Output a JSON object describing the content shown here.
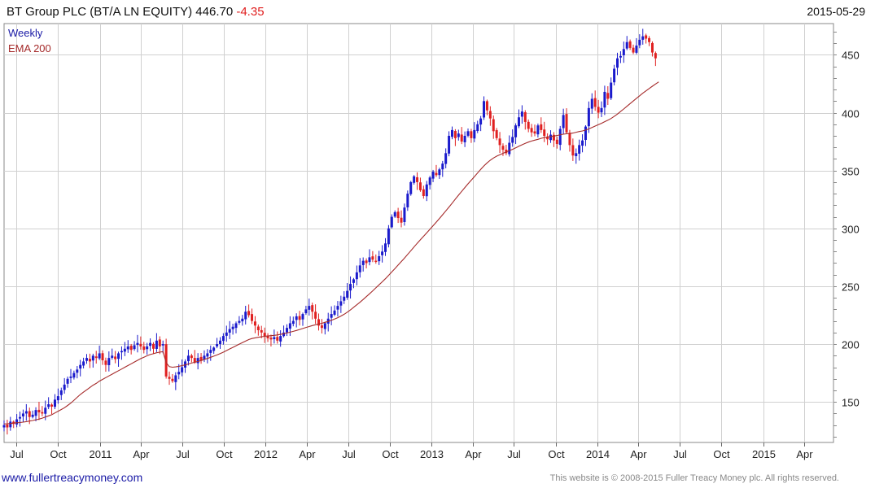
{
  "header": {
    "title": "BT Group PLC (BT/A LN EQUITY) 446.70",
    "change": "-4.35",
    "date": "2015-05-29"
  },
  "footer": {
    "website": "www.fullertreacymoney.com",
    "copyright": "This website is © 2008-2015 Fuller Treacy Money plc. All rights reserved."
  },
  "colors": {
    "up": "#1a1acc",
    "down": "#e02020",
    "ema": "#a52a2a",
    "grid": "#d0d0d0"
  },
  "chart_data": {
    "type": "candlestick",
    "title": "BT Group PLC (BT/A LN EQUITY) 446.70",
    "frequency": "Weekly",
    "ylim": [
      115,
      477
    ],
    "y_ticks": [
      150,
      200,
      250,
      300,
      350,
      400,
      450
    ],
    "x_range": [
      "2010-06-04",
      "2015-06-05"
    ],
    "x_ticks": [
      {
        "date": "2010-07-01",
        "label": "Jul"
      },
      {
        "date": "2010-10-01",
        "label": "Oct"
      },
      {
        "date": "2011-01-01",
        "label": "2011"
      },
      {
        "date": "2011-04-01",
        "label": "Apr"
      },
      {
        "date": "2011-07-01",
        "label": "Jul"
      },
      {
        "date": "2011-10-01",
        "label": "Oct"
      },
      {
        "date": "2012-01-01",
        "label": "2012"
      },
      {
        "date": "2012-04-01",
        "label": "Apr"
      },
      {
        "date": "2012-07-01",
        "label": "Jul"
      },
      {
        "date": "2012-10-01",
        "label": "Oct"
      },
      {
        "date": "2013-01-01",
        "label": "2013"
      },
      {
        "date": "2013-04-01",
        "label": "Apr"
      },
      {
        "date": "2013-07-01",
        "label": "Jul"
      },
      {
        "date": "2013-10-01",
        "label": "Oct"
      },
      {
        "date": "2014-01-01",
        "label": "2014"
      },
      {
        "date": "2014-04-01",
        "label": "Apr"
      },
      {
        "date": "2014-07-01",
        "label": "Jul"
      },
      {
        "date": "2014-10-01",
        "label": "Oct"
      },
      {
        "date": "2015-01-01",
        "label": "2015"
      },
      {
        "date": "2015-04-01",
        "label": "Apr"
      }
    ],
    "legend": [
      "Weekly",
      "EMA 200"
    ],
    "legend_position": "top-left",
    "first_week": "2010-06-04",
    "close": [
      130,
      128,
      133,
      131,
      135,
      137,
      140,
      142,
      137,
      139,
      143,
      141,
      140,
      145,
      148,
      146,
      152,
      155,
      160,
      165,
      170,
      172,
      175,
      178,
      182,
      185,
      188,
      185,
      190,
      188,
      192,
      186,
      182,
      188,
      190,
      187,
      192,
      194,
      196,
      198,
      195,
      199,
      201,
      198,
      195,
      198,
      201,
      196,
      203,
      198,
      200,
      172,
      170,
      168,
      173,
      176,
      180,
      185,
      190,
      188,
      184,
      188,
      186,
      190,
      192,
      195,
      197,
      200,
      203,
      207,
      210,
      213,
      215,
      218,
      220,
      222,
      228,
      225,
      220,
      216,
      212,
      210,
      207,
      205,
      204,
      206,
      203,
      207,
      210,
      214,
      218,
      220,
      224,
      221,
      226,
      230,
      233,
      228,
      222,
      216,
      214,
      218,
      222,
      226,
      229,
      233,
      237,
      241,
      246,
      252,
      256,
      262,
      268,
      272,
      270,
      275,
      273,
      271,
      276,
      280,
      287,
      300,
      310,
      314,
      309,
      305,
      318,
      330,
      340,
      345,
      340,
      333,
      328,
      338,
      344,
      349,
      346,
      351,
      356,
      365,
      380,
      385,
      378,
      382,
      375,
      380,
      384,
      378,
      385,
      390,
      395,
      410,
      402,
      395,
      384,
      378,
      372,
      368,
      365,
      374,
      379,
      389,
      396,
      401,
      392,
      386,
      383,
      382,
      389,
      385,
      380,
      377,
      381,
      376,
      373,
      386,
      398,
      383,
      372,
      363,
      365,
      372,
      376,
      388,
      404,
      412,
      405,
      400,
      404,
      418,
      412,
      426,
      438,
      447,
      449,
      455,
      461,
      456,
      452,
      458,
      463,
      466,
      464,
      461,
      452,
      447
    ],
    "ema200": [
      131,
      131.2,
      131.4,
      131.7,
      132,
      132.2,
      132.6,
      133,
      133.5,
      134,
      134.6,
      135.2,
      136,
      137,
      138,
      139,
      140.5,
      142,
      143.5,
      145,
      147,
      149,
      151.5,
      154,
      156.5,
      158.5,
      160.5,
      162.5,
      164.5,
      166,
      168,
      169.5,
      171,
      172.5,
      174,
      175.5,
      177,
      178.5,
      180,
      181.5,
      183,
      184.5,
      186,
      187.5,
      188.7,
      189.9,
      191,
      191.7,
      192.5,
      193,
      193.5,
      184,
      180.5,
      180,
      180.3,
      180.8,
      181.4,
      182,
      182.8,
      183.6,
      184.3,
      185,
      185.8,
      186.7,
      187.6,
      188.6,
      189.6,
      190.6,
      191.8,
      193,
      194.4,
      195.8,
      197.2,
      198.6,
      200,
      201.3,
      202.6,
      203.9,
      204.8,
      205.4,
      205.9,
      206.3,
      206.7,
      207,
      207.3,
      207.6,
      207.9,
      208.4,
      209,
      209.6,
      210.3,
      211,
      211.8,
      212.6,
      213.5,
      214.4,
      215.2,
      216,
      216.7,
      217.4,
      218,
      218.8,
      219.6,
      220.5,
      221.6,
      222.8,
      224.2,
      225.8,
      227.6,
      229.6,
      231.8,
      234,
      236.2,
      238.6,
      241,
      243.5,
      246,
      248.6,
      251.2,
      253.8,
      256.5,
      259.4,
      262.3,
      265.3,
      268.3,
      271.3,
      274.3,
      277.5,
      280.7,
      283.9,
      287.1,
      290.2,
      293.2,
      296.2,
      299.2,
      302.3,
      305.4,
      308.6,
      311.8,
      315.1,
      318.4,
      321.8,
      325.3,
      328.7,
      332,
      335.3,
      338.5,
      341.6,
      344.7,
      347.9,
      351,
      354,
      356.6,
      358.9,
      360.8,
      362.4,
      363.7,
      364.9,
      366,
      367.1,
      368.3,
      369.6,
      371,
      372.3,
      373.5,
      374.6,
      375.5,
      376.3,
      377,
      377.8,
      378.5,
      379.1,
      379.4,
      379.8,
      380.3,
      380.9,
      381.4,
      381.8,
      382,
      382.4,
      383.1,
      383.7,
      384.2,
      385,
      386,
      387.2,
      388.4,
      389.6,
      390.8,
      392.2,
      393.5,
      395,
      396.8,
      398.8,
      401,
      403.2,
      405.5,
      407.8,
      410.1,
      412.4,
      414.6,
      416.8,
      418.9,
      420.9,
      422.9,
      424.8,
      426.6
    ]
  }
}
